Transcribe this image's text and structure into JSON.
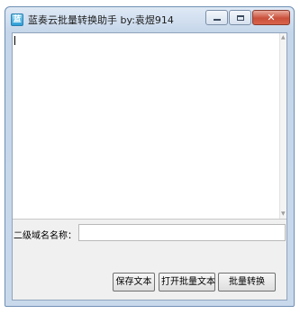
{
  "window": {
    "title": "蓝奏云批量转换助手 by:袁煜914",
    "icon_glyph": "蓝"
  },
  "controls": {
    "minimize": "minimize-icon",
    "maximize": "maximize-icon",
    "close": "close-icon",
    "close_glyph": "✕"
  },
  "editor": {
    "value": ""
  },
  "form": {
    "subdomain_label": "二级域名名称：",
    "subdomain_value": ""
  },
  "buttons": {
    "save": "保存文本",
    "open": "打开批量文本",
    "convert": "批量转换"
  },
  "colors": {
    "title_bar": "#c5d6ea",
    "close_button": "#c9503b",
    "client_bg": "#f0f0f0"
  }
}
